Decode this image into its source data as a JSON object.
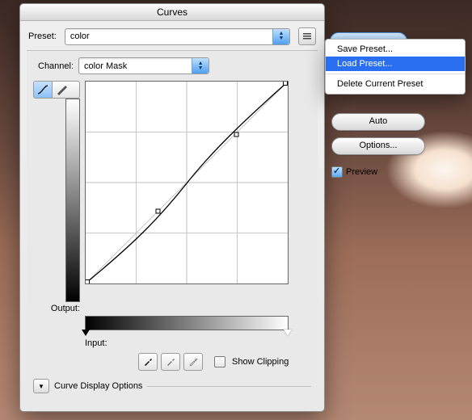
{
  "dialog": {
    "title": "Curves"
  },
  "preset": {
    "label": "Preset:",
    "value": "color"
  },
  "channel": {
    "label": "Channel:",
    "value": "color Mask"
  },
  "curve": {
    "output_label": "Output:",
    "input_label": "Input:",
    "show_clipping": "Show Clipping",
    "display_options": "Curve Display Options"
  },
  "side": {
    "auto": "Auto",
    "options": "Options...",
    "preview": "Preview"
  },
  "menu": {
    "save": "Save Preset...",
    "load": "Load Preset...",
    "delete": "Delete Current Preset"
  },
  "colors": {
    "highlight": "#2a6ff2",
    "aqua_end_top": "#bfe0ff",
    "aqua_end_bottom": "#4f9ff0"
  }
}
